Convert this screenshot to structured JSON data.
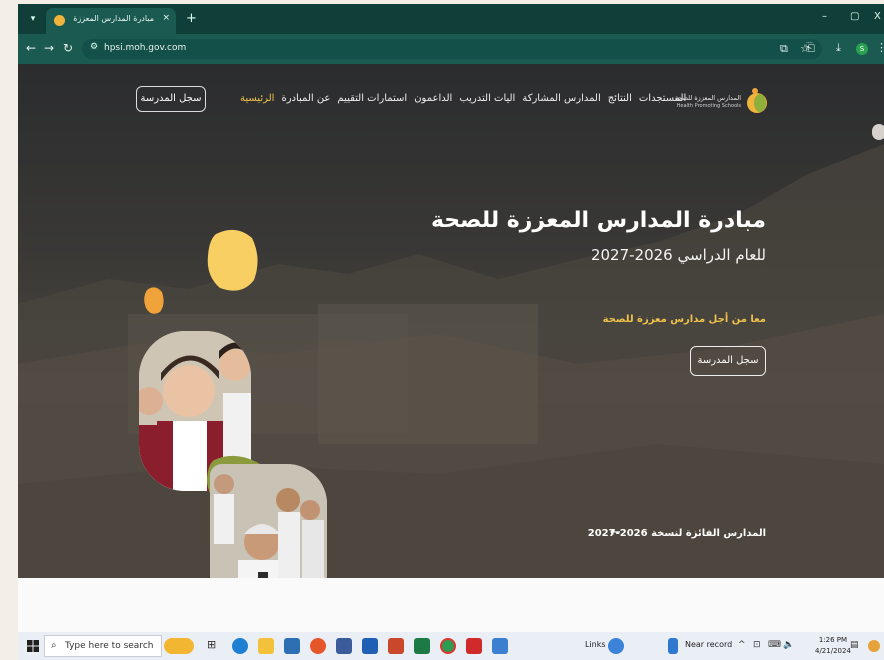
{
  "browser": {
    "tab_title": "مبادرة المدارس المعززة للصحة",
    "tab_close": "×",
    "new_tab": "+",
    "url": "hpsi.moh.gov.com",
    "win_min": "–",
    "win_max": "▢",
    "win_close": "X",
    "ext_badge": "S"
  },
  "site": {
    "logo_ar": "المدارس المعززة للصحة",
    "logo_en": "Health Promoting Schools",
    "nav": [
      {
        "label": "الرئيسية",
        "active": true
      },
      {
        "label": "عن المبادرة",
        "active": false
      },
      {
        "label": "استمارات التقييم",
        "active": false
      },
      {
        "label": "الداعمون",
        "active": false
      },
      {
        "label": "اليات التدريب",
        "active": false
      },
      {
        "label": "المدارس المشاركة",
        "active": false
      },
      {
        "label": "النتائج",
        "active": false
      },
      {
        "label": "المستجدات",
        "active": false
      }
    ],
    "register_label": "سجل المدرسة",
    "hero_title": "مبادرة المدارس المعززة للصحة",
    "hero_subtitle": "للعام الدراسي 2026-2027",
    "hero_tagline": "معا من أجل مدارس معززة للصحة",
    "hero_register": "سجل المدرسة",
    "winners_text": "المدارس الفائزة لنسخة  2026-2027",
    "winners_arrow": "←"
  },
  "taskbar": {
    "search_placeholder": "Type here to search",
    "links_label": "Links",
    "record_label": "Near record",
    "time": "1:26 PM",
    "date": "4/21/2024"
  },
  "colors": {
    "browser_dark": "#0f3f38",
    "browser_toolbar": "#1a5a50",
    "accent_yellow": "#f0c24b",
    "blob_yellow": "#f7cf63",
    "blob_orange": "#f0a33a",
    "blob_green": "#8a9a3c"
  }
}
